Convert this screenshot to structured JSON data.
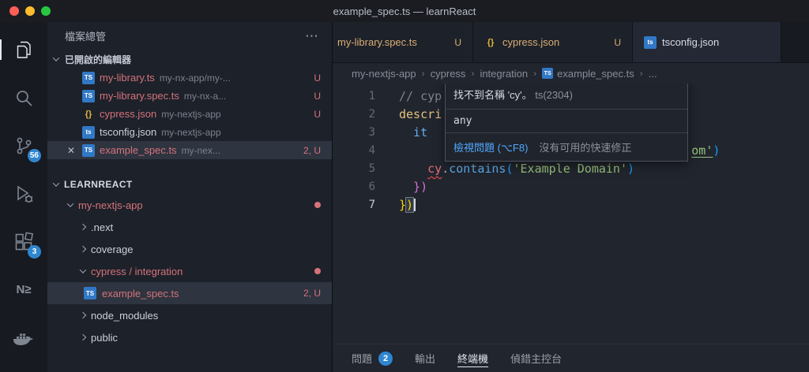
{
  "window": {
    "title": "example_spec.ts — learnReact"
  },
  "activity_bar": {
    "badges": {
      "source_control": "56",
      "extensions": "3"
    }
  },
  "sidebar": {
    "title": "檔案總管",
    "open_editors_header": "已開啟的編輯器",
    "open_editors": [
      {
        "icon": "TS",
        "name": "my-library.ts",
        "desc": "my-nx-app/my-...",
        "badge": "U"
      },
      {
        "icon": "TS",
        "name": "my-library.spec.ts",
        "desc": "my-nx-a...",
        "badge": "U"
      },
      {
        "icon": "{}",
        "name": "cypress.json",
        "desc": "my-nextjs-app",
        "badge": "U"
      },
      {
        "icon": "ts",
        "name": "tsconfig.json",
        "desc": "my-nextjs-app",
        "badge": ""
      },
      {
        "icon": "TS",
        "name": "example_spec.ts",
        "desc": "my-nex...",
        "badge": "2, U"
      }
    ],
    "workspace": "LEARNREACT",
    "tree": [
      {
        "label": "my-nextjs-app"
      },
      {
        "label": ".next"
      },
      {
        "label": "coverage"
      },
      {
        "label": "cypress / integration"
      },
      {
        "label": "example_spec.ts",
        "icon": "TS",
        "badge": "2, U"
      },
      {
        "label": "node_modules"
      },
      {
        "label": "public"
      }
    ]
  },
  "tabs": [
    {
      "label": "my-library.spec.ts",
      "badge": "U"
    },
    {
      "icon": "{}",
      "label": "cypress.json",
      "badge": "U"
    },
    {
      "icon": "ts",
      "label": "tsconfig.json",
      "badge": ""
    }
  ],
  "breadcrumb": {
    "items": [
      "my-nextjs-app",
      "cypress",
      "integration",
      "example_spec.ts",
      "..."
    ],
    "file_icon": "TS"
  },
  "code": {
    "line_numbers": [
      "1",
      "2",
      "3",
      "4",
      "5",
      "6",
      "7"
    ],
    "l1": "// cyp",
    "l2": "descri",
    "l3": "  it",
    "l4_pad": "                                         ",
    "l4_string": "om'",
    "l4_paren": ")",
    "l5_indent": "    ",
    "l5_obj": "cy",
    "l5_dot": ".",
    "l5_method": "contains",
    "l5_open": "(",
    "l5_str": "'Example Domain'",
    "l5_close": ")",
    "l6": "  })",
    "l7_brace": "}",
    "l7_paren": ")"
  },
  "tooltip": {
    "message": "找不到名稱 'cy'。",
    "code": "ts(2304)",
    "type_info": "any",
    "action": "檢視問題 (⌥F8)",
    "hint": "沒有可用的快速修正"
  },
  "panel": {
    "tabs": [
      {
        "label": "問題",
        "badge": "2"
      },
      {
        "label": "輸出"
      },
      {
        "label": "終端機"
      },
      {
        "label": "偵錯主控台"
      }
    ]
  }
}
